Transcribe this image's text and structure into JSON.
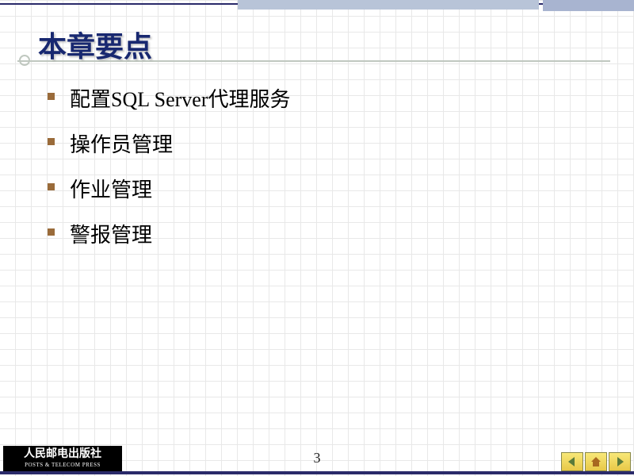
{
  "title": "本章要点",
  "bullets": [
    "配置SQL Server代理服务",
    "操作员管理",
    "作业管理",
    "警报管理"
  ],
  "page_number": "3",
  "publisher": {
    "cn": "人民邮电出版社",
    "en": "POSTS & TELECOM PRESS"
  }
}
